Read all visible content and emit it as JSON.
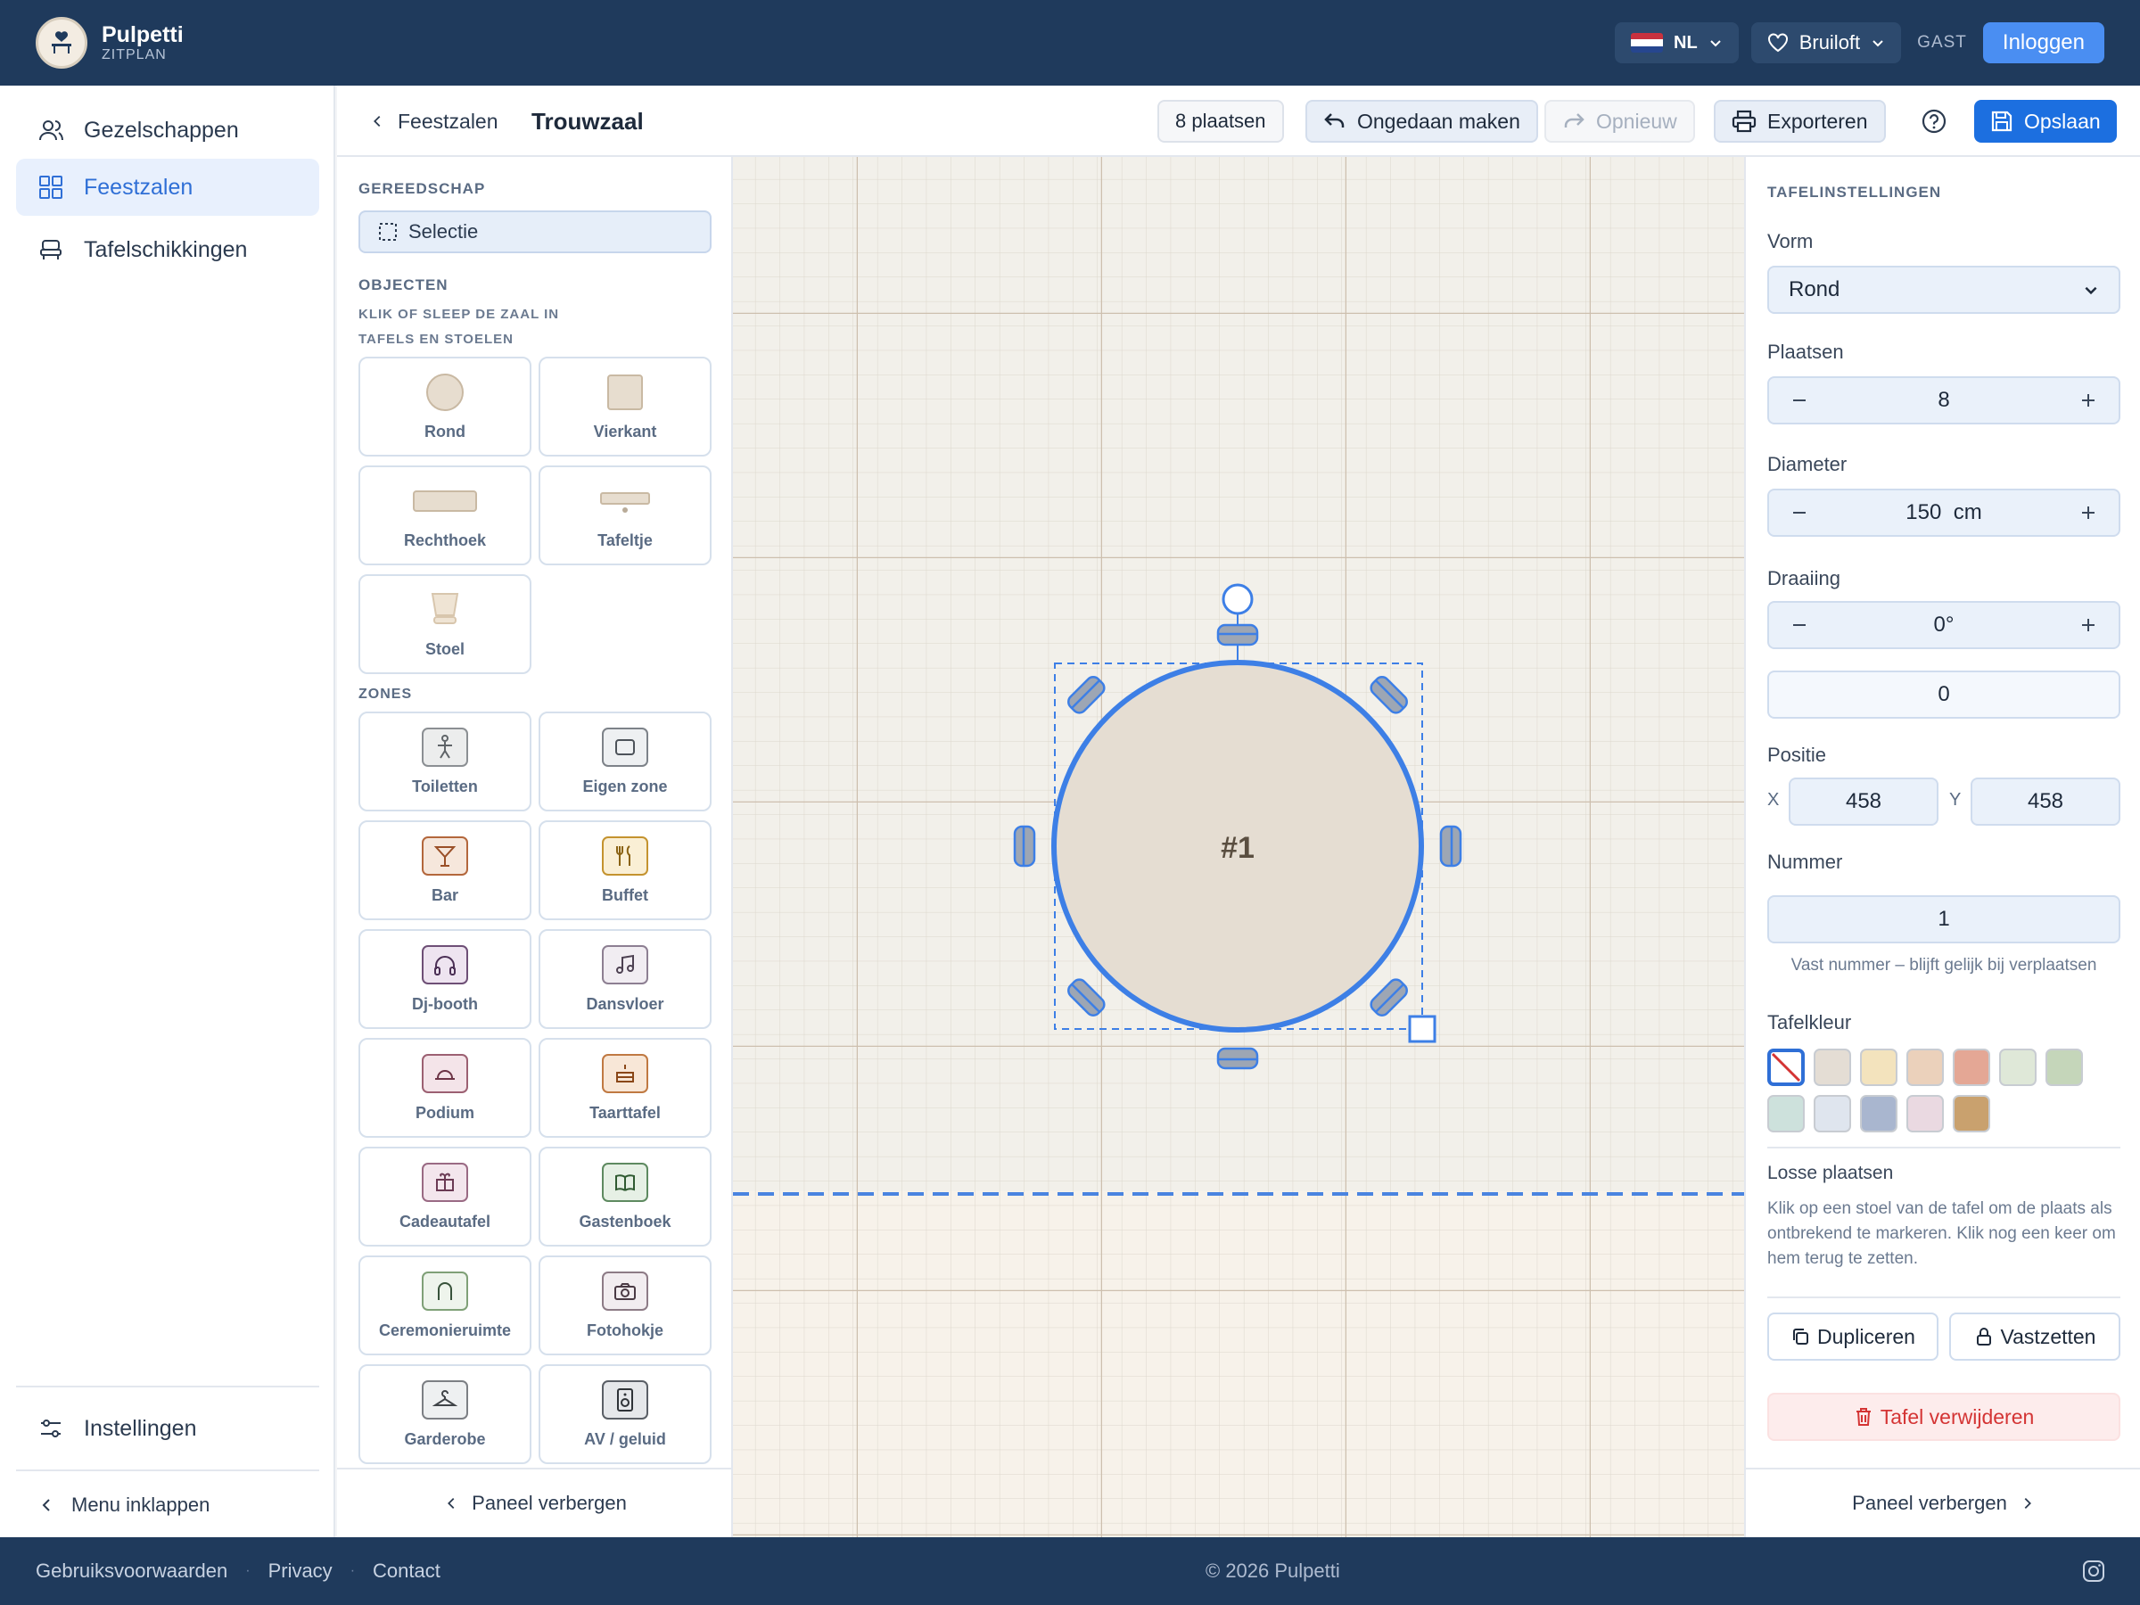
{
  "app": {
    "name": "Pulpetti",
    "subtitle": "ZITPLAN"
  },
  "topbar": {
    "language": "NL",
    "event_type": "Bruiloft",
    "guest_label": "GAST",
    "login_label": "Inloggen"
  },
  "sidebar": {
    "items": [
      {
        "label": "Gezelschappen",
        "icon": "users-icon"
      },
      {
        "label": "Feestzalen",
        "icon": "grid-icon"
      },
      {
        "label": "Tafelschikkingen",
        "icon": "seat-icon"
      }
    ],
    "settings_label": "Instellingen",
    "collapse_label": "Menu inklappen"
  },
  "editor": {
    "back_label": "Feestzalen",
    "room_name": "Trouwzaal",
    "seats_badge": "8 plaatsen",
    "undo_label": "Ongedaan maken",
    "redo_label": "Opnieuw",
    "export_label": "Exporteren",
    "save_label": "Opslaan"
  },
  "tools": {
    "tools_heading": "GEREEDSCHAP",
    "select_label": "Selectie",
    "objects_heading": "OBJECTEN",
    "objects_hint": "KLIK OF SLEEP DE ZAAL IN",
    "tables_heading": "TAFELS EN STOELEN",
    "tables": [
      "Rond",
      "Vierkant",
      "Rechthoek",
      "Tafeltje",
      "Stoel"
    ],
    "zones_heading": "ZONES",
    "zones": [
      "Toiletten",
      "Eigen zone",
      "Bar",
      "Buffet",
      "Dj-booth",
      "Dansvloer",
      "Podium",
      "Taarttafel",
      "Cadeautafel",
      "Gastenboek",
      "Ceremonieruimte",
      "Fotohokje",
      "Garderobe",
      "AV / geluid"
    ],
    "hide_panel_label": "Paneel verbergen"
  },
  "canvas": {
    "table_label": "#1"
  },
  "table_settings": {
    "heading": "TAFELINSTELLINGEN",
    "shape_label": "Vorm",
    "shape_value": "Rond",
    "seats_label": "Plaatsen",
    "seats_value": "8",
    "diameter_label": "Diameter",
    "diameter_value": "150",
    "diameter_unit": "cm",
    "rotation_label": "Draaiing",
    "rotation_value": "0°",
    "rotation_input": "0",
    "position_label": "Positie",
    "x_label": "X",
    "x_value": "458",
    "y_label": "Y",
    "y_value": "458",
    "number_label": "Nummer",
    "number_value": "1",
    "number_hint": "Vast nummer – blijft gelijk bij verplaatsen",
    "color_label": "Tafelkleur",
    "colors": [
      "none",
      "#e4ddd4",
      "#f3e3bd",
      "#ebd1bb",
      "#e4a795",
      "#dfe8d8",
      "#c5d6ba",
      "#cde1dc",
      "#dfe5ee",
      "#a9b6cf",
      "#ead9e1",
      "#c9a16e"
    ],
    "loose_seats_label": "Losse plaatsen",
    "loose_seats_help": "Klik op een stoel van de tafel om de plaats als ontbrekend te markeren. Klik nog een keer om hem terug te zetten.",
    "duplicate_label": "Dupliceren",
    "lock_label": "Vastzetten",
    "delete_label": "Tafel verwijderen",
    "hide_panel_label": "Paneel verbergen"
  },
  "footer": {
    "links": [
      "Gebruiksvoorwaarden",
      "Privacy",
      "Contact"
    ],
    "copyright": "© 2026 Pulpetti"
  }
}
